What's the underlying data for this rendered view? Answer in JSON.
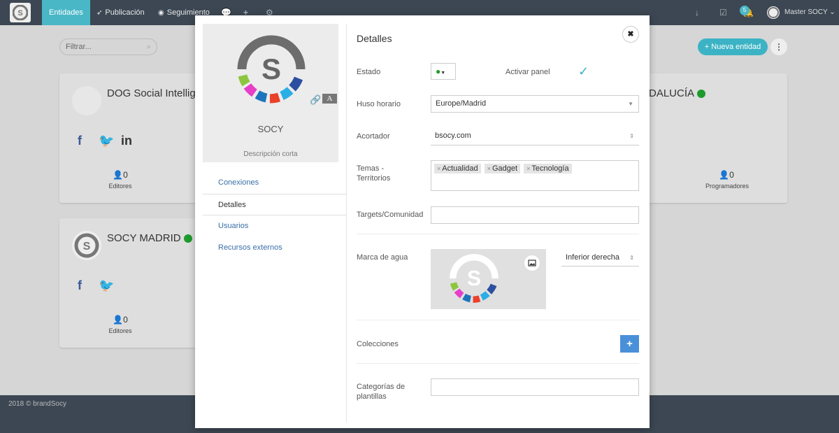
{
  "nav": {
    "items": [
      "Entidades",
      "Publicación",
      "Seguimiento"
    ],
    "badge_count": "5",
    "user_name": "Master SOCY"
  },
  "page": {
    "filter_placeholder": "Filtrar...",
    "new_entity_label": "Nueva entidad",
    "footer": "2018 © brandSocy"
  },
  "cards": [
    {
      "title": "DOG Social Intellige",
      "count": "0",
      "label": "Editores"
    },
    {
      "title": "DALUCÍA",
      "count": "0",
      "label": "Programadores"
    },
    {
      "title": "SOCY MADRID",
      "count": "0",
      "label": "Editores"
    }
  ],
  "modal": {
    "profile": {
      "name": "SOCY",
      "description": "Descripción corta"
    },
    "menu": [
      "Conexiones",
      "Detalles",
      "Usuarios",
      "Recursos externos"
    ],
    "active_menu_index": 1,
    "title": "Detalles",
    "fields": {
      "estado_label": "Estado",
      "activar_panel_label": "Activar panel",
      "huso_label": "Huso horario",
      "huso_value": "Europe/Madrid",
      "acortador_label": "Acortador",
      "acortador_value": "bsocy.com",
      "temas_label_1": "Temas -",
      "temas_label_2": "Territorios",
      "tags": [
        "Actualidad",
        "Gadget",
        "Tecnología"
      ],
      "targets_label": "Targets/Comunidad",
      "marca_label": "Marca de agua",
      "marca_position": "Inferior derecha",
      "colecciones_label": "Colecciones",
      "categorias_label_1": "Categorías de",
      "categorias_label_2": "plantillas"
    }
  },
  "colors": {
    "nav_bg": "#3c4753",
    "accent": "#4ab7c7",
    "status_green": "#1e9b2d",
    "link_blue": "#3a6fa8",
    "add_blue": "#4a90d9"
  }
}
